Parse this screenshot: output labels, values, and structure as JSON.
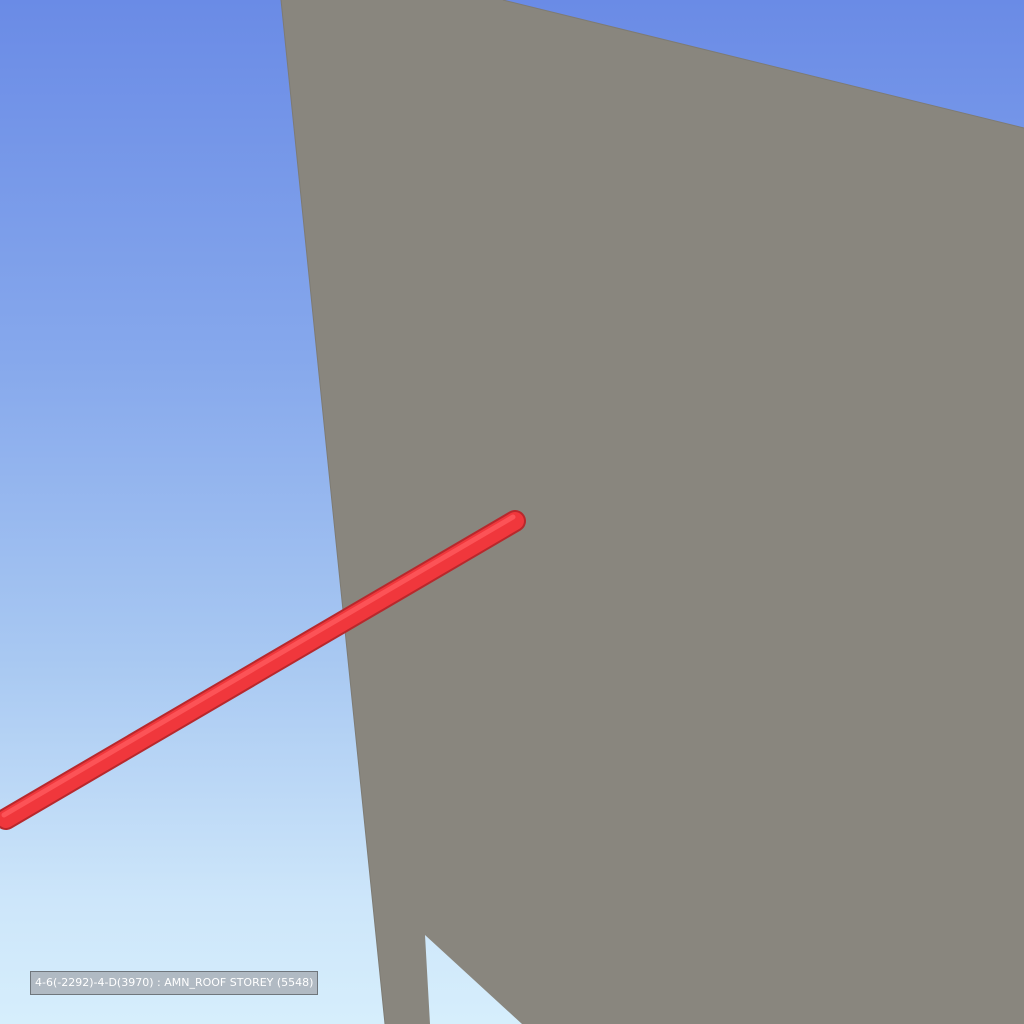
{
  "viewer": {
    "selection_label": "4-6(-2292)-4-D(3970) : AMN_ROOF STOREY (5548)",
    "colors": {
      "sky_top": "#6a8be6",
      "sky_bottom": "#d6eefc",
      "wall": "#89867e",
      "wall_edge": "#7e7b73",
      "rod": "#f0373c",
      "rod_highlight": "#ff5a5e",
      "rod_shadow": "#b8282c"
    },
    "objects": {
      "wall": "wall-panel",
      "rod": "selected-element"
    }
  }
}
